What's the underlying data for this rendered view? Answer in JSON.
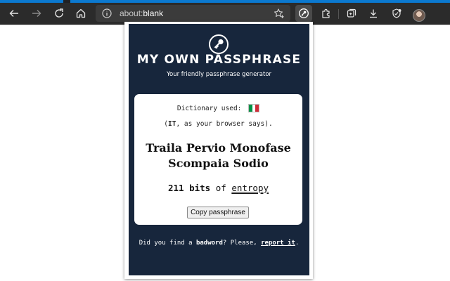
{
  "browser": {
    "address_bar": {
      "url_prefix": "about:",
      "url_host": "blank"
    },
    "icons": [
      "back-icon",
      "forward-icon",
      "refresh-icon",
      "home-icon",
      "info-icon",
      "add-favorite-icon",
      "passphrase-extension-icon",
      "extensions-icon",
      "collections-icon",
      "downloads-icon",
      "browser-essentials-icon",
      "profile-avatar"
    ]
  },
  "popup": {
    "title": "MY OWN PASSPHRASE",
    "subtitle": "Your friendly passphrase generator",
    "dictionary_label": "Dictionary used:",
    "dictionary_flag": "italian-flag-icon",
    "language_code": "IT",
    "language_note_suffix": ", as your browser says).",
    "language_note_prefix": "(",
    "passphrase_line1": "Traila Pervio Monofase",
    "passphrase_line2": "Scompaia Sodio",
    "entropy_bits": "211 bits",
    "entropy_of": "of",
    "entropy_link": "entropy",
    "copy_button": "Copy passphrase",
    "footer_prefix": "Did you find a ",
    "footer_badword": "badword",
    "footer_middle": "? Please, ",
    "footer_report": "report it",
    "footer_suffix": "."
  },
  "colors": {
    "popup_bg": "#17263c",
    "card_bg": "#ffffff",
    "toolbar_bg": "#2b2b2b",
    "accent": "#0b79d0",
    "flag_green": "#009246",
    "flag_white": "#ffffff",
    "flag_red": "#ce2b37"
  }
}
